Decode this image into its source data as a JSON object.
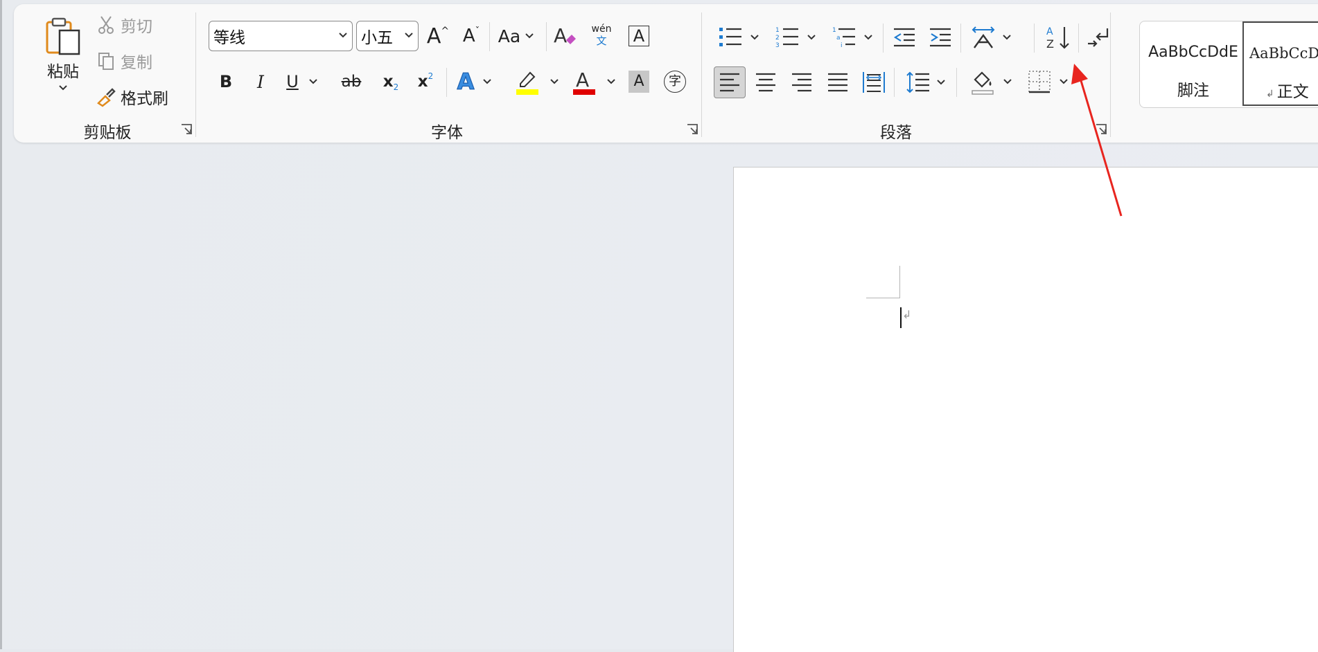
{
  "clipboard": {
    "paste_label": "粘贴",
    "cut_label": "剪切",
    "copy_label": "复制",
    "format_painter_label": "格式刷",
    "group_label": "剪贴板"
  },
  "font": {
    "font_name": "等线",
    "font_size": "小五",
    "grow_font_glyph": "A",
    "shrink_font_glyph": "A",
    "change_case_glyph": "Aa",
    "phonetic_top": "wén",
    "phonetic_bottom": "文",
    "char_border_glyph": "A",
    "bold_glyph": "B",
    "italic_glyph": "I",
    "underline_glyph": "U",
    "strike_glyph": "ab",
    "subscript_glyph": "x",
    "subscript_small": "2",
    "superscript_glyph": "x",
    "superscript_small": "2",
    "text_effect_glyph": "A",
    "font_color_glyph": "A",
    "char_shading_glyph": "A",
    "enclose_char_glyph": "字",
    "highlight_color": "#ffff00",
    "font_color": "#e00000",
    "group_label": "字体"
  },
  "paragraph": {
    "group_label": "段落"
  },
  "styles": {
    "items": [
      {
        "preview": "AaBbCcDdE",
        "name": "脚注"
      },
      {
        "preview": "AaBbCcDdE",
        "name": "正文"
      }
    ],
    "return_mark": "↲"
  },
  "document": {
    "return_mark": "↲"
  },
  "colors": {
    "accent": "#1e7bd0",
    "annotation_arrow": "#e8251f"
  }
}
